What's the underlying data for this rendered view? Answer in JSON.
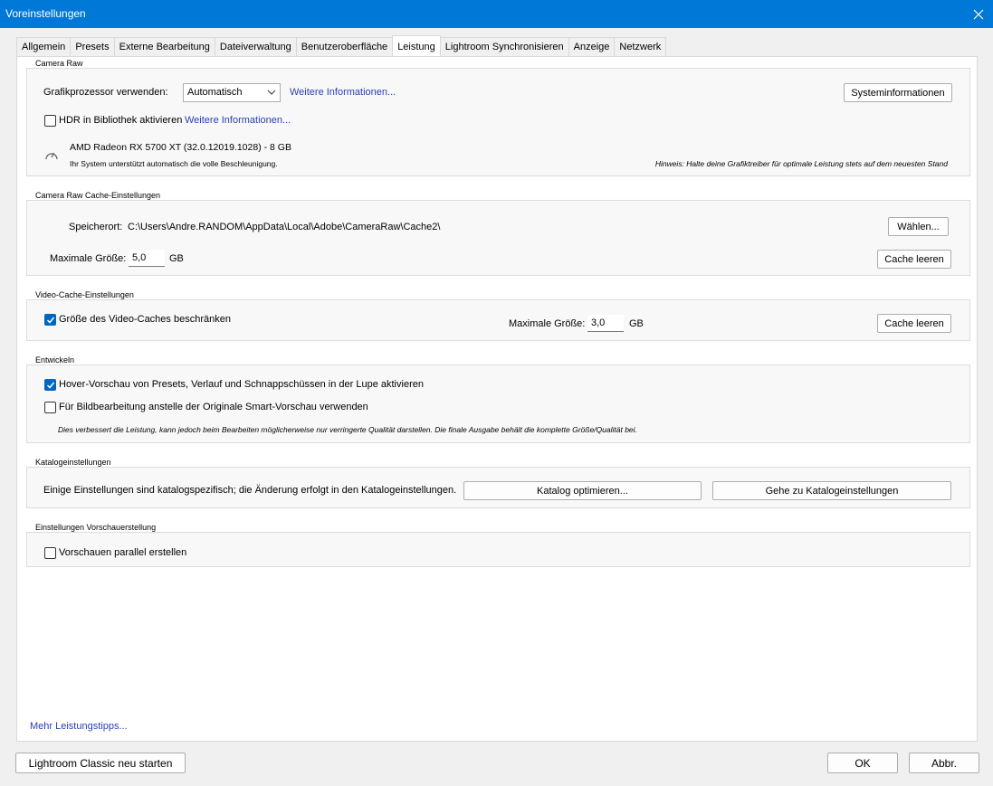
{
  "window": {
    "title": "Voreinstellungen"
  },
  "tabs": [
    {
      "label": "Allgemein"
    },
    {
      "label": "Presets"
    },
    {
      "label": "Externe Bearbeitung"
    },
    {
      "label": "Dateiverwaltung"
    },
    {
      "label": "Benutzeroberfläche"
    },
    {
      "label": "Leistung",
      "active": true
    },
    {
      "label": "Lightroom Synchronisieren"
    },
    {
      "label": "Anzeige"
    },
    {
      "label": "Netzwerk"
    }
  ],
  "camera_raw": {
    "title": "Camera Raw",
    "gpu_label": "Grafikprozessor verwenden:",
    "gpu_value": "Automatisch",
    "gpu_link": "Weitere Informationen...",
    "sysinfo_button": "Systeminformationen",
    "hdr_label": "HDR in Bibliothek aktivieren",
    "hdr_checked": false,
    "hdr_link": "Weitere Informationen...",
    "gpu_name": "AMD Radeon RX 5700 XT (32.0.12019.1028) - 8 GB",
    "gpu_status": "Ihr System unterstützt automatisch die volle Beschleunigung.",
    "hint": "Hinweis: Halte deine Grafiktreiber für optimale Leistung stets auf dem neuesten Stand"
  },
  "cache": {
    "title": "Camera Raw Cache-Einstellungen",
    "location_label": "Speicherort:",
    "location_value": "C:\\Users\\Andre.RANDOM\\AppData\\Local\\Adobe\\CameraRaw\\Cache2\\",
    "choose_button": "Wählen...",
    "max_label": "Maximale Größe:",
    "max_value": "5,0",
    "max_unit": "GB",
    "clear_button": "Cache leeren"
  },
  "video_cache": {
    "title": "Video-Cache-Einstellungen",
    "limit_label": "Größe des Video-Caches beschränken",
    "limit_checked": true,
    "max_label": "Maximale Größe:",
    "max_value": "3,0",
    "max_unit": "GB",
    "clear_button": "Cache leeren"
  },
  "develop": {
    "title": "Entwickeln",
    "hover_label": "Hover-Vorschau von Presets, Verlauf und Schnappschüssen in der Lupe aktivieren",
    "hover_checked": true,
    "smart_label": "Für Bildbearbeitung anstelle der Originale Smart-Vorschau verwenden",
    "smart_checked": false,
    "smart_note": "Dies verbessert die Leistung, kann jedoch beim Bearbeiten möglicherweise nur verringerte Qualität darstellen. Die finale Ausgabe behält die komplette Größe/Qualität bei."
  },
  "catalog": {
    "title": "Katalogeinstellungen",
    "text": "Einige Einstellungen sind katalogspezifisch; die Änderung erfolgt in den Katalogeinstellungen.",
    "optimize_button": "Katalog optimieren...",
    "goto_button": "Gehe zu Katalogeinstellungen"
  },
  "preview": {
    "title": "Einstellungen Vorschauerstellung",
    "parallel_label": "Vorschauen parallel erstellen",
    "parallel_checked": false
  },
  "more_tips_link": "Mehr Leistungstipps...",
  "footer": {
    "restart_button": "Lightroom Classic neu starten",
    "ok_button": "OK",
    "cancel_button": "Abbr."
  },
  "colors": {
    "titlebar": "#0078d7",
    "checkbox_checked": "#0067c0",
    "link": "#2b40b5"
  }
}
